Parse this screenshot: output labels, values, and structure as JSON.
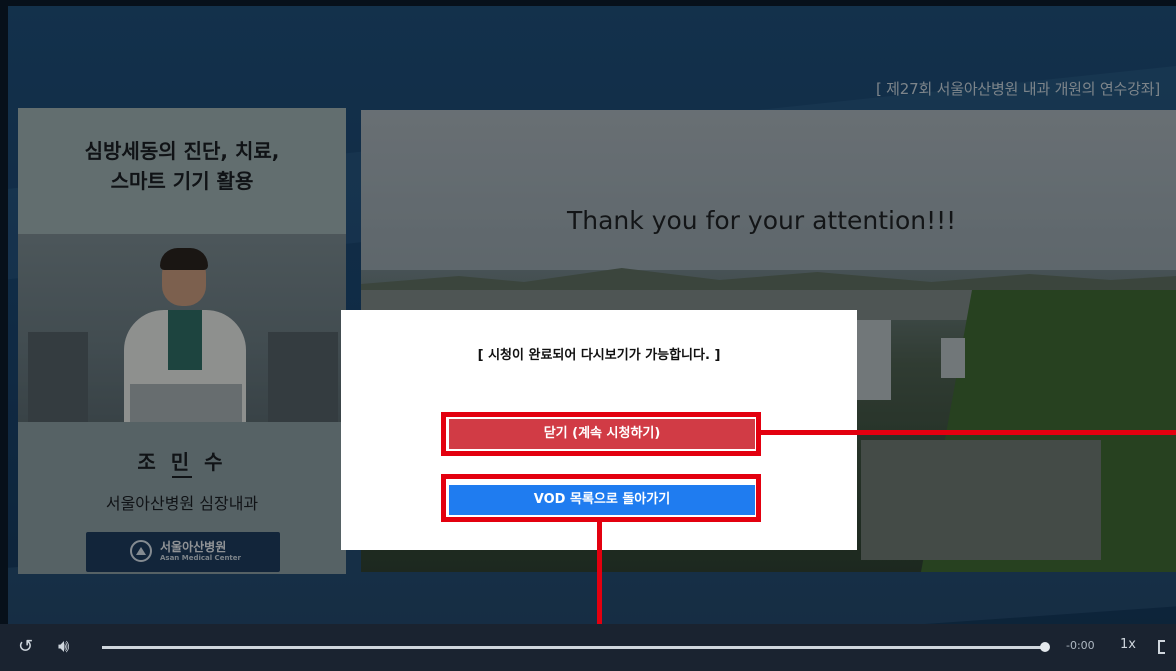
{
  "player": {
    "course_title": "[ 제27회 서울아산병원 내과 개원의 연수강좌]",
    "lecture_title": [
      "심방세동의 진단, 치료,",
      "스마트 기기 활용"
    ],
    "speaker_name": "조 민 수",
    "speaker_dept": "서울아산병원 심장내과",
    "hospital_badge": {
      "name_ko": "서울아산병원",
      "name_en": "Asan Medical Center"
    },
    "slide_text": "Thank you for your attention!!!"
  },
  "modal": {
    "message": "[ 시청이 완료되어 다시보기가 가능합니다. ]",
    "close_button": "닫기 (계속 시청하기)",
    "vod_button": "VOD 목록으로 돌아가기"
  },
  "controls": {
    "time": "-0:00",
    "speed": "1x",
    "progress": 1.0,
    "icons": [
      "replay-icon",
      "volume-icon",
      "fullscreen-icon"
    ]
  },
  "colors": {
    "close_button": "#d13b45",
    "vod_button": "#1f7cf0",
    "highlight": "#e3000f"
  }
}
